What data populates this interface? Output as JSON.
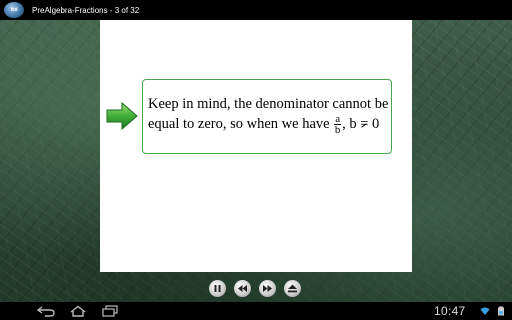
{
  "titlebar": {
    "app_icon_text": "kid",
    "title": "PreAlgebra-Fractions - 3 of 32"
  },
  "note": {
    "line1": "Keep in mind, the denominator cannot be",
    "line2_prefix": "equal to zero, so when we have",
    "frac_num": "a",
    "frac_den": "b",
    "after_frac": ",  b",
    "neq_symbol": "=",
    "zero": "0"
  },
  "controls": [
    {
      "name": "pause-icon"
    },
    {
      "name": "rewind-icon"
    },
    {
      "name": "fast-forward-icon"
    },
    {
      "name": "eject-icon"
    }
  ],
  "navbar": {
    "clock": "10:47"
  },
  "colors": {
    "border_green": "#44a848",
    "arrow_green": "#3fae3a"
  }
}
